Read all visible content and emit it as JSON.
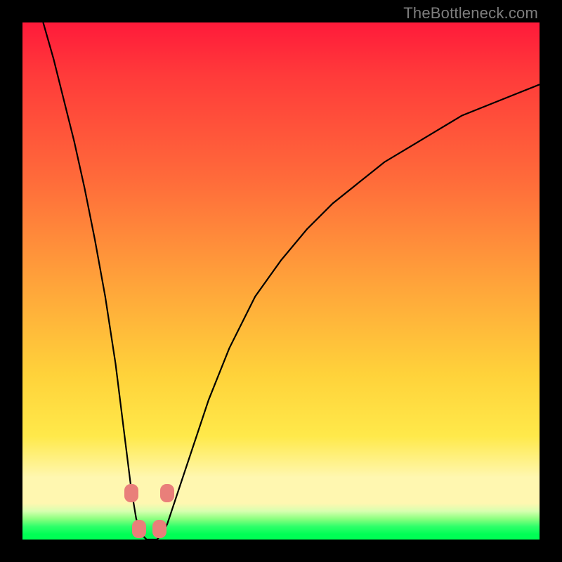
{
  "watermark": {
    "text": "TheBottleneck.com"
  },
  "chart_data": {
    "type": "line",
    "title": "",
    "xlabel": "",
    "ylabel": "",
    "xlim": [
      0,
      100
    ],
    "ylim": [
      0,
      100
    ],
    "grid": false,
    "background_gradient": {
      "direction": "vertical",
      "stops": [
        {
          "pos": 0.0,
          "color": "#ff1a3a"
        },
        {
          "pos": 0.5,
          "color": "#ffa23a"
        },
        {
          "pos": 0.8,
          "color": "#ffe94a"
        },
        {
          "pos": 0.95,
          "color": "#8cff80"
        },
        {
          "pos": 1.0,
          "color": "#00ff55"
        }
      ]
    },
    "series": [
      {
        "name": "bottleneck-curve",
        "color": "#000000",
        "x": [
          4,
          6,
          8,
          10,
          12,
          14,
          16,
          18,
          20,
          21,
          22,
          23,
          24,
          25,
          26,
          27,
          28,
          30,
          33,
          36,
          40,
          45,
          50,
          55,
          60,
          65,
          70,
          75,
          80,
          85,
          90,
          95,
          100
        ],
        "y": [
          100,
          93,
          85,
          77,
          68,
          58,
          47,
          34,
          18,
          10,
          4,
          1,
          0,
          0,
          0,
          1,
          3,
          9,
          18,
          27,
          37,
          47,
          54,
          60,
          65,
          69,
          73,
          76,
          79,
          82,
          84,
          86,
          88
        ]
      }
    ],
    "markers": [
      {
        "name": "left-upper",
        "x": 21.0,
        "y": 9,
        "color": "#e97f7a"
      },
      {
        "name": "left-lower",
        "x": 22.5,
        "y": 2,
        "color": "#e97f7a"
      },
      {
        "name": "right-lower",
        "x": 26.5,
        "y": 2,
        "color": "#e97f7a"
      },
      {
        "name": "right-upper",
        "x": 28.0,
        "y": 9,
        "color": "#e97f7a"
      }
    ]
  }
}
